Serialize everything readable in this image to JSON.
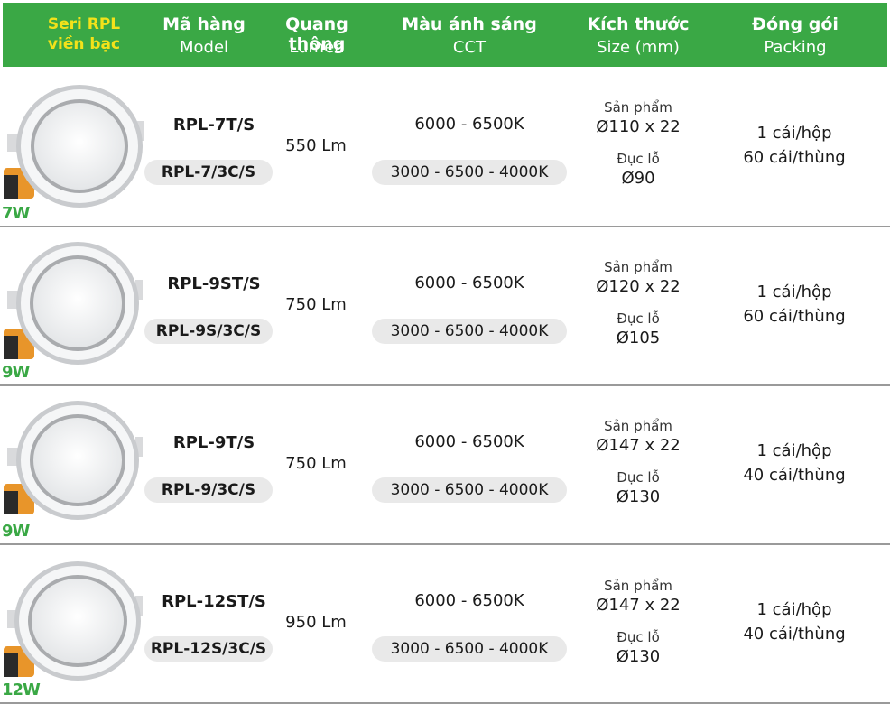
{
  "header": {
    "series_line1": "Seri RPL",
    "series_line2": "viền bạc",
    "model_vi": "Mã hàng",
    "model_en": "Model",
    "lumen_vi": "Quang thông",
    "lumen_en": "Lumen",
    "cct_vi": "Màu ánh sáng",
    "cct_en": "CCT",
    "size_vi": "Kích thước",
    "size_en": "Size (mm)",
    "pack_vi": "Đóng gói",
    "pack_en": "Packing"
  },
  "colors": {
    "header_bg": "#3aa845",
    "series_text": "#f3e21a",
    "watt_text": "#3aa845",
    "pill_bg": "#e9e9e9"
  },
  "rows": [
    {
      "watt": "7W",
      "model1": "RPL-7T/S",
      "model2": "RPL-7/3C/S",
      "lumen": "550 Lm",
      "cct1": "6000 - 6500K",
      "cct2": "3000 - 6500 - 4000K",
      "size_label": "Sản phẩm",
      "size_dim": "Ø110 x 22",
      "hole_label": "Đục lỗ",
      "hole_dim": "Ø90",
      "pack1": "1 cái/hộp",
      "pack2": "60 cái/thùng"
    },
    {
      "watt": "9W",
      "model1": "RPL-9ST/S",
      "model2": "RPL-9S/3C/S",
      "lumen": "750 Lm",
      "cct1": "6000 - 6500K",
      "cct2": "3000 - 6500 - 4000K",
      "size_label": "Sản phẩm",
      "size_dim": "Ø120 x 22",
      "hole_label": "Đục lỗ",
      "hole_dim": "Ø105",
      "pack1": "1 cái/hộp",
      "pack2": "60 cái/thùng"
    },
    {
      "watt": "9W",
      "model1": "RPL-9T/S",
      "model2": "RPL-9/3C/S",
      "lumen": "750 Lm",
      "cct1": "6000 - 6500K",
      "cct2": "3000 - 6500 - 4000K",
      "size_label": "Sản phẩm",
      "size_dim": "Ø147 x 22",
      "hole_label": "Đục lỗ",
      "hole_dim": "Ø130",
      "pack1": "1 cái/hộp",
      "pack2": "40 cái/thùng"
    },
    {
      "watt": "12W",
      "model1": "RPL-12ST/S",
      "model2": "RPL-12S/3C/S",
      "lumen": "950 Lm",
      "cct1": "6000 - 6500K",
      "cct2": "3000 - 6500 - 4000K",
      "size_label": "Sản phẩm",
      "size_dim": "Ø147 x 22",
      "hole_label": "Đục lỗ",
      "hole_dim": "Ø130",
      "pack1": "1 cái/hộp",
      "pack2": "40 cái/thùng"
    }
  ]
}
